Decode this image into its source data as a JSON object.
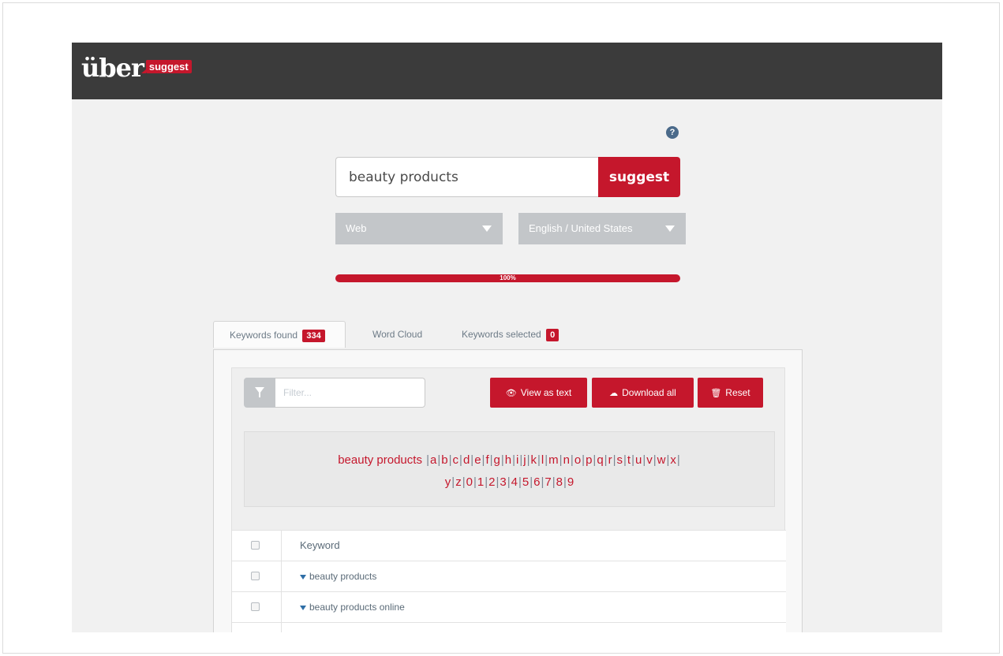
{
  "app": {
    "logo": {
      "main": "über",
      "tag": "suggest"
    },
    "help_icon": "?"
  },
  "search": {
    "query": "beauty products",
    "button_label": "suggest"
  },
  "selects": {
    "type_label": "Web",
    "language_label": "English / United States"
  },
  "progress": {
    "value_percent": 100,
    "text": "100%"
  },
  "tabs": {
    "keywords_found_label": "Keywords found",
    "keywords_found_count": "334",
    "word_cloud_label": "Word Cloud",
    "keywords_selected_label": "Keywords selected",
    "keywords_selected_count": "0"
  },
  "toolbar": {
    "filter_placeholder": "Filter...",
    "view_as_text_label": "View as text",
    "download_all_label": "Download all",
    "reset_label": "Reset"
  },
  "letters": {
    "prefix": "beauty products",
    "line1": [
      "a",
      "b",
      "c",
      "d",
      "e",
      "f",
      "g",
      "h",
      "i",
      "j",
      "k",
      "l",
      "m",
      "n",
      "o",
      "p",
      "q",
      "r",
      "s",
      "t",
      "u",
      "v",
      "w",
      "x"
    ],
    "line2": [
      "y",
      "z",
      "0",
      "1",
      "2",
      "3",
      "4",
      "5",
      "6",
      "7",
      "8",
      "9"
    ]
  },
  "table": {
    "header": "Keyword",
    "rows": [
      "beauty products",
      "beauty products online"
    ]
  },
  "colors": {
    "brand_red": "#c5172c",
    "header_dark": "#3b3b3b",
    "select_grey": "#c3c6c9"
  }
}
